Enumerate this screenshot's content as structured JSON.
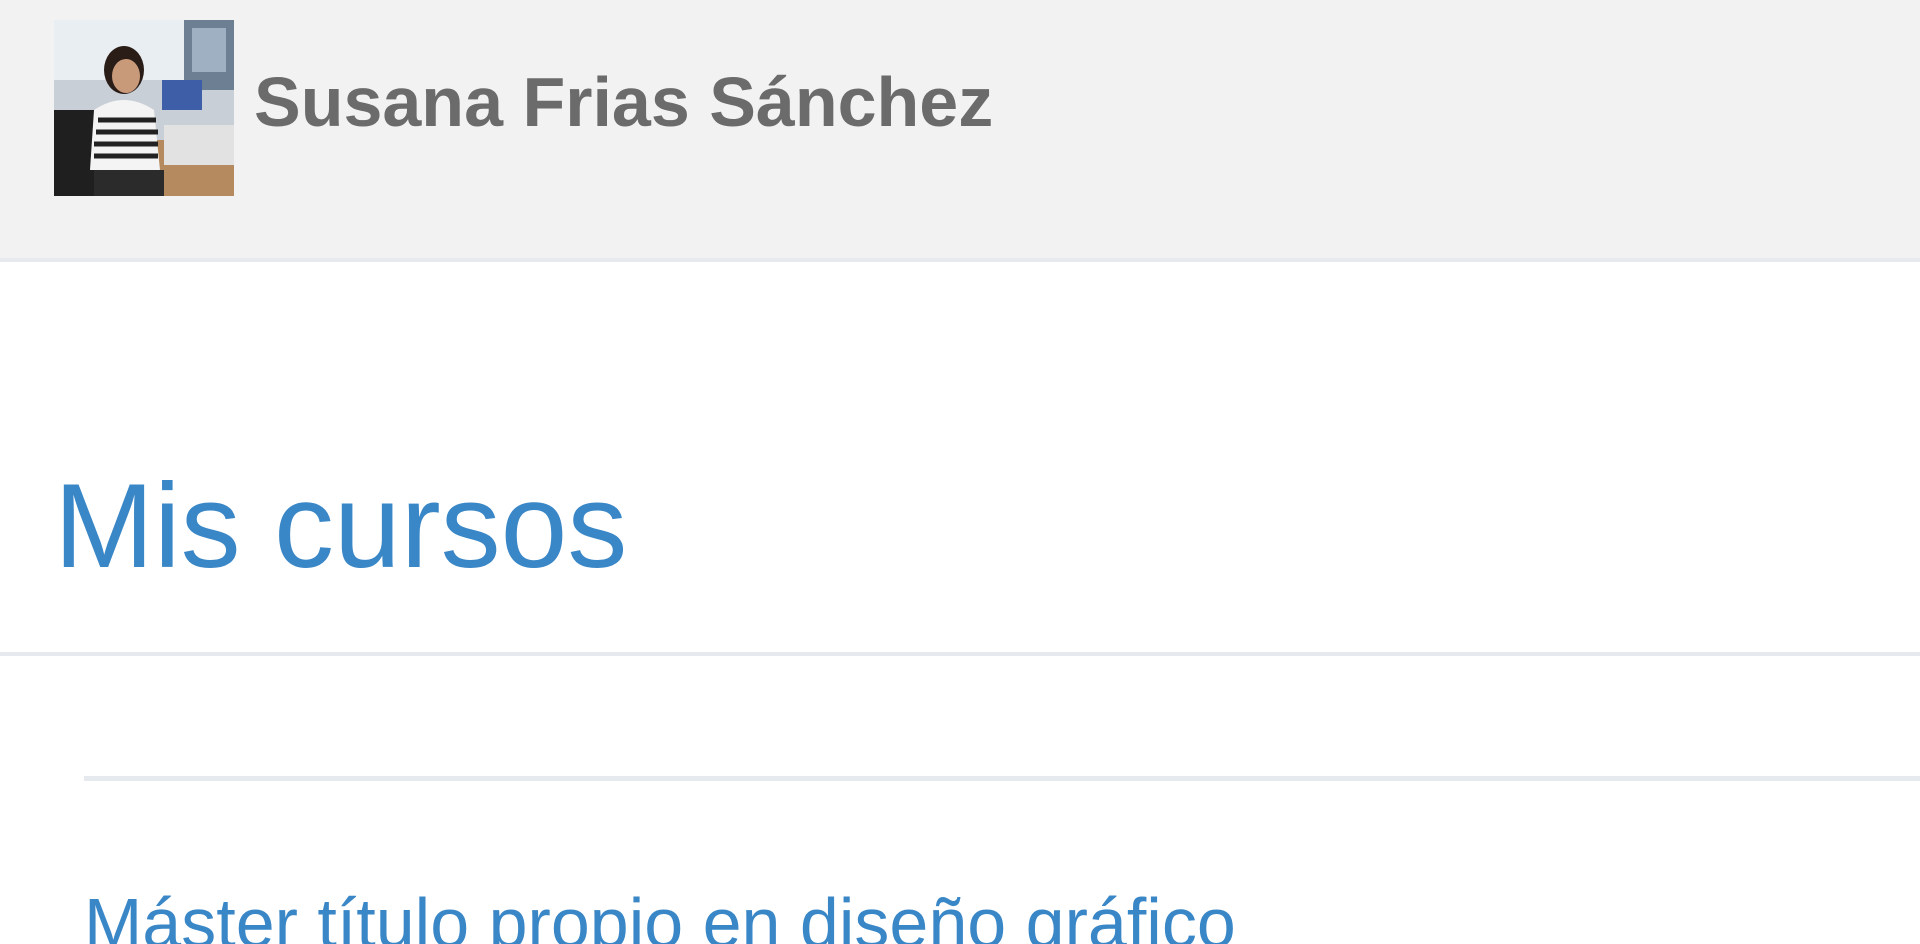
{
  "user": {
    "name": "Susana Frias Sánchez",
    "avatar_alt": "Foto de Susana Frias Sánchez"
  },
  "main": {
    "title": "Mis cursos",
    "courses": [
      {
        "name": "Máster título propio en diseño gráfico"
      }
    ]
  },
  "colors": {
    "header_bg": "#f2f2f2",
    "accent": "#3a87c7",
    "name_text": "#6b6b6b",
    "divider": "#e6eaee"
  }
}
